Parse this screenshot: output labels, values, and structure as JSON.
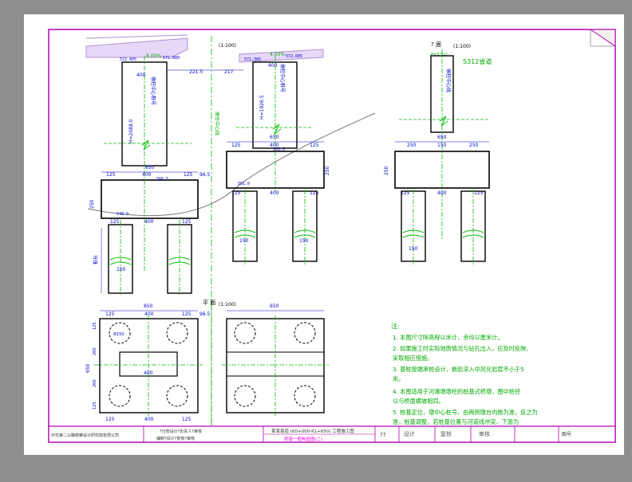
{
  "colors": {
    "page_background": "#8e8e8e",
    "paper": "#ffffff",
    "line": "#000000",
    "dimension": "#0000cc",
    "centerline": "#00bb00",
    "note_text": "#00aa00",
    "border": "#b000b0",
    "magenta_text": "#ff00ff"
  },
  "views": {
    "v1": {
      "superstructure_grade": "4.00%",
      "elev_left": "572.405",
      "elev_right": "572.880",
      "gap_dim": "221.5",
      "gap_dim2": "217",
      "pier_w": "400",
      "pier_height": "H=2088.0",
      "pier_note": "墩柱中心桩号",
      "cap_width": "650",
      "cap_side_dims": [
        "125",
        "400",
        "125"
      ],
      "cap_offset": "96.5",
      "cap_elev": "566.5",
      "cap_height": "250",
      "pile_dims": [
        "125",
        "400",
        "125"
      ],
      "pile_elev": "548.0",
      "pile_dia": "150",
      "pile_label": "桩长"
    },
    "v2": {
      "title_paren": "(1:100)",
      "grade": "4.00%",
      "elev_left": "572.305",
      "elev_right": "572.685",
      "pier_w": "400",
      "pier_height": "H=1926.5",
      "pier_note": "墩柱中心桩号",
      "center_note": "墩台中心线",
      "cap_width": "650",
      "cap_side_dims": [
        "125",
        "400",
        "125"
      ],
      "cap_elev": "553.5",
      "cap_height": "250",
      "pile_elev": "551.0",
      "pile_dia": [
        "150",
        "150"
      ],
      "top_dims": [
        "125",
        "400",
        "125"
      ]
    },
    "v3": {
      "title": "? 面",
      "title_paren": "(1:100)",
      "top_note": "S312省道",
      "pier_note": "墩柱中心线",
      "cap_width": "650",
      "top_dims": [
        "250",
        "150",
        "250"
      ],
      "cap_height": "250",
      "pile_dims": [
        "125",
        "400",
        "125"
      ],
      "pile_dia": "150",
      "v_label": "P=3.5x?"
    },
    "plan": {
      "title": "平 面",
      "title_paren": "(1:100)",
      "width": "650",
      "width2": "650",
      "dims_top": [
        "125",
        "400",
        "125"
      ],
      "offset": "96.5",
      "dims_side": [
        "125",
        "200",
        "200",
        "125"
      ],
      "total": "650",
      "inner": "400",
      "pile_dia": "Φ150",
      "dims_bottom": [
        "125",
        "400",
        "125"
      ]
    }
  },
  "notes": {
    "heading": "注:",
    "items": [
      "1. 本图尺寸除高程以米计，余均以厘米计。",
      "2. 如果施工时实际地质情况与钻孔出入，应及时反映，",
      "   采取相应措施。",
      "3. 基桩按端承桩设计，嵌岩深入中风化岩层不小于5",
      "   米。",
      "4. 本图适用于河滩墩墩柱的桩基式桥墩，图中桩径",
      "   以与桥面横坡相同。",
      "5. 桩基定位，墩中心桩号，由两侧墩台内侧为准，反之为",
      "   准，桩基调整，若桩基位置与河道线冲突，下游为"
    ]
  },
  "title_block": {
    "cells": [
      "中交第二公路勘察设计研究院有限公司",
      "?分管设计?负责人?审核",
      "编制?设计?复核?审核",
      "某某县道 (K0+000-K1+650) 工程施工图",
      "桥墩一般构造图(二)",
      "??",
      "设计",
      "复核",
      "审核",
      "图号"
    ]
  }
}
